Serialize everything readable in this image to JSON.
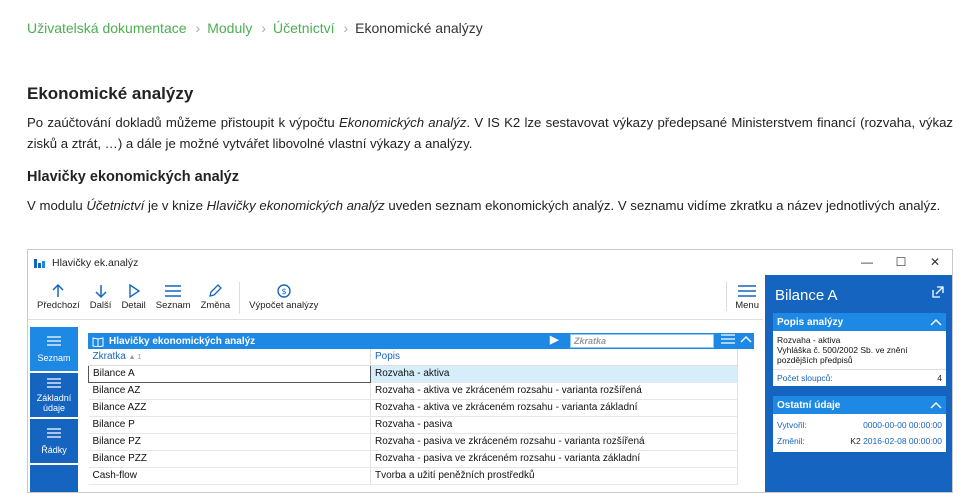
{
  "breadcrumb": {
    "items": [
      "Uživatelská dokumentace",
      "Moduly",
      "Účetnictví"
    ],
    "current": "Ekonomické analýzy"
  },
  "page_title": "Ekonomické analýzy",
  "para1": {
    "part1": "Po zaúčtování dokladů můžeme přistoupit k výpočtu ",
    "em1": "Ekonomických analýz",
    "part2": ". V IS K2 lze sestavovat výkazy předepsané Ministerstvem financí (rozvaha, výkaz zisků a ztrát, …) a dále je možné vytvářet libovolné vlastní výkazy a analýzy."
  },
  "subtitle": "Hlavičky ekonomických analýz",
  "para2": {
    "part1": "V modulu ",
    "em1": "Účetnictví",
    "part2": " je v knize ",
    "em2": "Hlavičky ekonomických analýz",
    "part3": " uveden seznam ekonomických analýz. V seznamu vidíme zkratku a název jednotlivých analýz."
  },
  "window": {
    "title": "Hlavičky ek.analýz",
    "controls": [
      "—",
      "☐",
      "✕"
    ],
    "toolbar": [
      {
        "label": "Předchozí",
        "icon": "arrow-up-icon"
      },
      {
        "label": "Další",
        "icon": "arrow-down-icon"
      },
      {
        "label": "Detail",
        "icon": "play-icon"
      },
      {
        "label": "Seznam",
        "icon": "list-icon"
      },
      {
        "label": "Změna",
        "icon": "pencil-icon"
      },
      {
        "label": "Výpočet analýzy",
        "icon": "refresh-icon"
      }
    ],
    "menu_label": "Menu",
    "nav": [
      {
        "label": "Seznam"
      },
      {
        "label": "Základní údaje"
      },
      {
        "label": "Řádky"
      }
    ],
    "grid": {
      "title": "Hlavičky ekonomických analýz",
      "search_placeholder": "Zkratka",
      "columns": [
        "Zkratka",
        "Popis"
      ],
      "sort_indicator": "▲ 1",
      "rows": [
        {
          "zkratka": "Bilance A",
          "popis": "Rozvaha - aktiva"
        },
        {
          "zkratka": "Bilance AZ",
          "popis": "Rozvaha - aktiva ve zkráceném rozsahu - varianta rozšířená"
        },
        {
          "zkratka": "Bilance AZZ",
          "popis": "Rozvaha - aktiva ve zkráceném rozsahu - varianta základní"
        },
        {
          "zkratka": "Bilance P",
          "popis": "Rozvaha - pasiva"
        },
        {
          "zkratka": "Bilance PZ",
          "popis": "Rozvaha - pasiva ve zkráceném rozsahu - varianta rozšířená"
        },
        {
          "zkratka": "Bilance PZZ",
          "popis": "Rozvaha - pasiva ve zkráceném rozsahu - varianta základní"
        },
        {
          "zkratka": "Cash-flow",
          "popis": "Tvorba a užití peněžních prostředků"
        }
      ]
    },
    "right_panel": {
      "title": "Bilance A",
      "popis_head": "Popis analýzy",
      "popis_lines": [
        "Rozvaha - aktiva",
        "Vyhláška č. 500/2002 Sb. ve znění pozdějších předpisů"
      ],
      "pocet_label": "Počet sloupců:",
      "pocet_value": "4",
      "ostatni_head": "Ostatní údaje",
      "vytvoril_label": "Vytvořil:",
      "vytvoril_value": "0000-00-00 00:00:00",
      "zmenil_label": "Změnil:",
      "zmenil_user": "K2",
      "zmenil_value": "2016-02-08 00:00:00"
    }
  },
  "colors": {
    "link_green": "#4caf50",
    "k2_blue_dark": "#1565c0",
    "k2_blue": "#1e88e5"
  }
}
